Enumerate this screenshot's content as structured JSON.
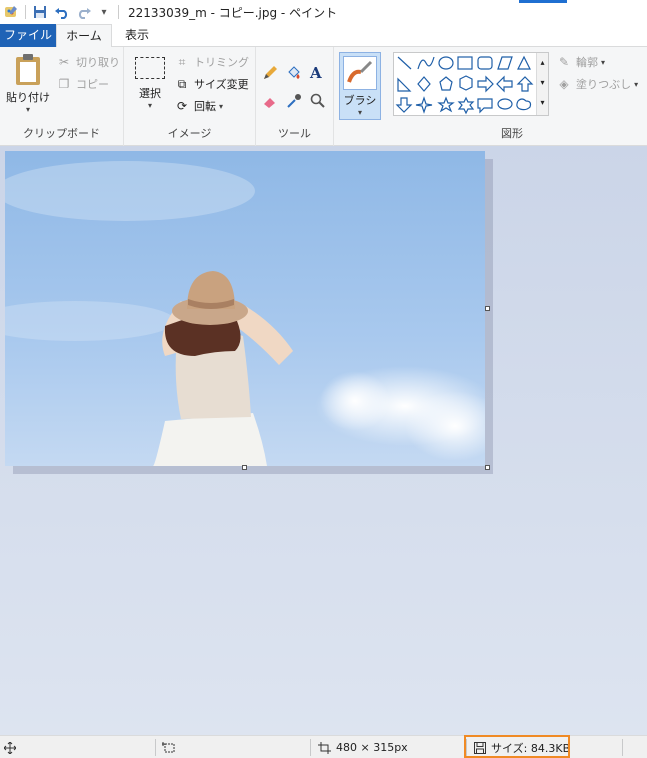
{
  "titlebar": {
    "title": "22133039_m - コピー.jpg - ペイント"
  },
  "tabs": [
    {
      "label": "ファイル"
    },
    {
      "label": "ホーム"
    },
    {
      "label": "表示"
    }
  ],
  "clipboard": {
    "paste_label": "貼り付け",
    "cut_label": "切り取り",
    "copy_label": "コピー",
    "group_label": "クリップボード"
  },
  "image": {
    "select_label": "選択",
    "crop_label": "トリミング",
    "resize_label": "サイズ変更",
    "rotate_label": "回転",
    "group_label": "イメージ"
  },
  "tools": {
    "group_label": "ツール",
    "icons": [
      "pencil-icon",
      "fill-icon",
      "text-icon",
      "eraser-icon",
      "color-picker-icon",
      "magnifier-icon"
    ]
  },
  "brushes": {
    "label": "ブラシ"
  },
  "shapes": {
    "outline_label": "輪郭",
    "fill_label": "塗りつぶし",
    "group_label": "図形"
  },
  "status": {
    "dimensions": "480 × 315px",
    "file_size": "サイズ: 84.3KB",
    "highlight_color": "#f08a24"
  }
}
